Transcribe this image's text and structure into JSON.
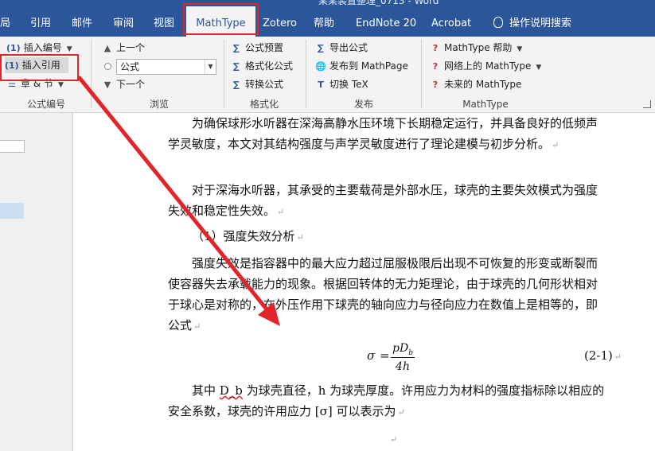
{
  "window": {
    "title": "某某装置整理_0713 - Word"
  },
  "tabs": [
    {
      "label": "局"
    },
    {
      "label": "引用"
    },
    {
      "label": "邮件"
    },
    {
      "label": "审阅"
    },
    {
      "label": "视图"
    },
    {
      "label": "MathType",
      "active": true
    },
    {
      "label": "Zotero"
    },
    {
      "label": "帮助"
    },
    {
      "label": "EndNote 20"
    },
    {
      "label": "Acrobat"
    },
    {
      "label": "操作说明搜索"
    }
  ],
  "ribbon": {
    "equation_numbers": {
      "label": "公式编号",
      "insert_number": "插入编号",
      "insert_reference": "插入引用",
      "chapter_section": "章 & 节"
    },
    "browse": {
      "label": "浏览",
      "previous": "上一个",
      "combo_value": "公式",
      "next": "下一个"
    },
    "format": {
      "label": "格式化",
      "presets": "公式预置",
      "format_equations": "格式化公式",
      "convert": "转换公式"
    },
    "publish": {
      "label": "发布",
      "export": "导出公式",
      "publish_mathpage": "发布到 MathPage",
      "toggle_tex": "切换 TeX"
    },
    "mathtype": {
      "label": "MathType",
      "help": "MathType 帮助",
      "online": "网络上的 MathType",
      "future": "未来的 MathType"
    }
  },
  "icons": {
    "insert_number": "(1)",
    "insert_reference": "(1)",
    "chapter_section": "☰",
    "previous": "▲",
    "next": "▼",
    "presets": "∑",
    "format_equations": "∑",
    "convert": "∑",
    "export": "∑",
    "publish_mathpage": "🌐",
    "toggle_tex": "T",
    "help": "?",
    "online": "?",
    "future": "?"
  },
  "document": {
    "p1": "为确保球形水听器在深海高静水压环境下长期稳定运行，并具备良好的低频声学灵敏度，本文对其结构强度与声学灵敏度进行了理论建模与初步分析。",
    "p2": "对于深海水听器，其承受的主要载荷是外部水压，球壳的主要失效模式为强度失效和稳定性失效。",
    "p3": "（1）强度失效分析",
    "p4": "强度失效是指容器中的最大应力超过屈服极限后出现不可恢复的形变或断裂而使容器失去承载能力的现象。根据回转体的无力矩理论，由于球壳的几何形状相对于球心是对称的，在外压作用下球壳的轴向应力与径向应力在数值上是相等的，即公式",
    "formula": {
      "lhs": "σ",
      "equals": "=",
      "numerator": "pD",
      "num_sub": "b",
      "denominator": "4h",
      "number": "(2-1)"
    },
    "p5_prefix": "其中 ",
    "p5_var": "D_b",
    "p5_rest": " 为球壳直径，h 为球壳厚度。许用应力为材料的强度指标除以相应的安全系数，球壳的许用应力 [σ] 可以表示为",
    "para_mark": "↵"
  },
  "colors": {
    "ribbon_blue": "#2b579a",
    "highlight_red": "#e0252b"
  }
}
